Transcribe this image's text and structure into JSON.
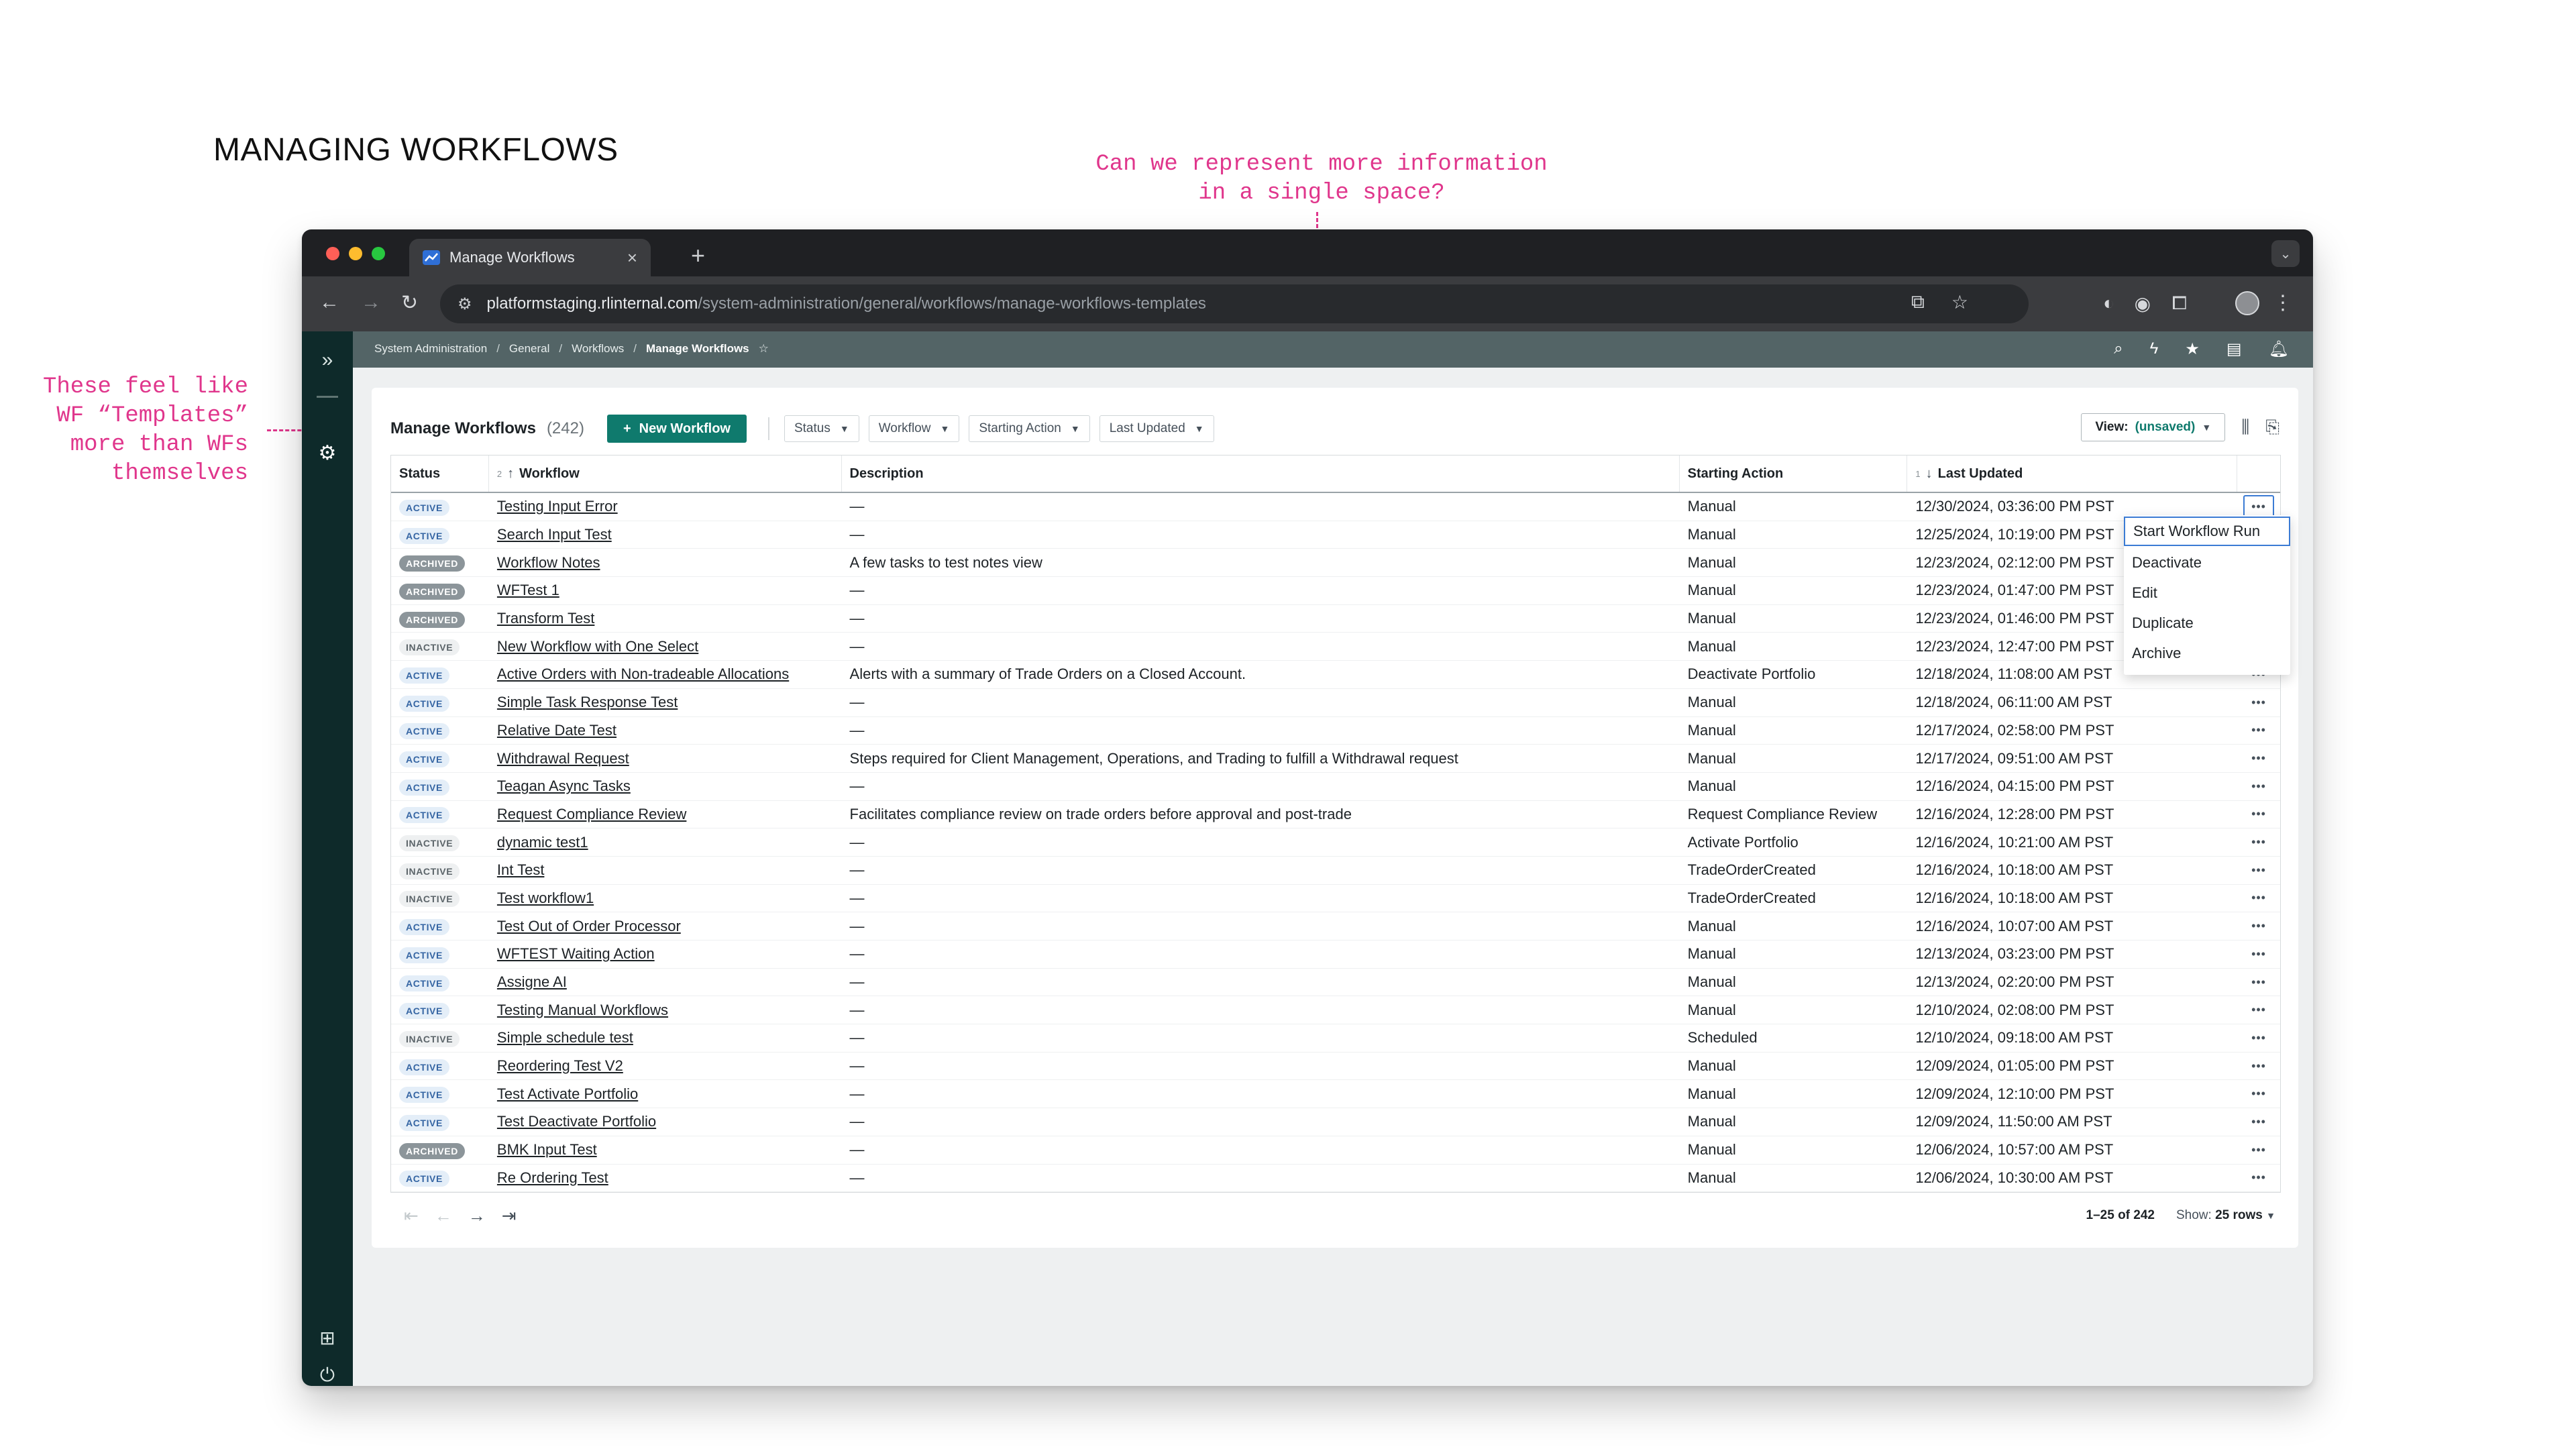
{
  "slide": {
    "title": "MANAGING WORKFLOWS",
    "annotation_top_line1": "Can we represent more information",
    "annotation_top_line2": "in a single space?",
    "annotation_left_line1": "These feel like",
    "annotation_left_line2": "WF “Templates”",
    "annotation_left_line3": "more than WFs",
    "annotation_left_line4": "themselves",
    "annotation_color": "#e0368c"
  },
  "browser": {
    "tab_title": "Manage Workflows",
    "url_host": "platformstaging.rlinternal.com",
    "url_path": "/system-administration/general/workflows/manage-workflows-templates"
  },
  "breadcrumb": [
    "System Administration",
    "General",
    "Workflows",
    "Manage Workflows"
  ],
  "toolbar": {
    "title": "Manage Workflows",
    "count": "(242)",
    "new_button": "New Workflow",
    "filters": [
      "Status",
      "Workflow",
      "Starting Action",
      "Last Updated"
    ],
    "view_label": "View:",
    "view_value": "(unsaved)"
  },
  "columns": {
    "status": "Status",
    "workflow": "Workflow",
    "workflow_sort_index": "2",
    "description": "Description",
    "starting_action": "Starting Action",
    "last_updated": "Last Updated",
    "last_updated_sort_index": "1"
  },
  "rows": [
    {
      "status": "ACTIVE",
      "workflow": "Testing Input Error",
      "description": "—",
      "action": "Manual",
      "updated": "12/30/2024, 03:36:00 PM PST"
    },
    {
      "status": "ACTIVE",
      "workflow": "Search Input Test",
      "description": "—",
      "action": "Manual",
      "updated": "12/25/2024, 10:19:00 PM PST"
    },
    {
      "status": "ARCHIVED",
      "workflow": "Workflow Notes",
      "description": "A few tasks to test notes view",
      "action": "Manual",
      "updated": "12/23/2024, 02:12:00 PM PST"
    },
    {
      "status": "ARCHIVED",
      "workflow": "WFTest 1",
      "description": "—",
      "action": "Manual",
      "updated": "12/23/2024, 01:47:00 PM PST"
    },
    {
      "status": "ARCHIVED",
      "workflow": "Transform Test",
      "description": "—",
      "action": "Manual",
      "updated": "12/23/2024, 01:46:00 PM PST"
    },
    {
      "status": "INACTIVE",
      "workflow": "New Workflow with One Select",
      "description": "—",
      "action": "Manual",
      "updated": "12/23/2024, 12:47:00 PM PST"
    },
    {
      "status": "ACTIVE",
      "workflow": "Active Orders with Non-tradeable Allocations",
      "description": "Alerts with a summary of Trade Orders on a Closed Account.",
      "action": "Deactivate Portfolio",
      "updated": "12/18/2024, 11:08:00 AM PST"
    },
    {
      "status": "ACTIVE",
      "workflow": "Simple Task Response Test",
      "description": "—",
      "action": "Manual",
      "updated": "12/18/2024, 06:11:00 AM PST"
    },
    {
      "status": "ACTIVE",
      "workflow": "Relative Date Test",
      "description": "—",
      "action": "Manual",
      "updated": "12/17/2024, 02:58:00 PM PST"
    },
    {
      "status": "ACTIVE",
      "workflow": "Withdrawal Request",
      "description": "Steps required for Client Management, Operations, and Trading to fulfill a Withdrawal request",
      "action": "Manual",
      "updated": "12/17/2024, 09:51:00 AM PST"
    },
    {
      "status": "ACTIVE",
      "workflow": "Teagan Async Tasks",
      "description": "—",
      "action": "Manual",
      "updated": "12/16/2024, 04:15:00 PM PST"
    },
    {
      "status": "ACTIVE",
      "workflow": "Request Compliance Review",
      "description": "Facilitates compliance review on trade orders before approval and post-trade",
      "action": "Request Compliance Review",
      "updated": "12/16/2024, 12:28:00 PM PST"
    },
    {
      "status": "INACTIVE",
      "workflow": "dynamic test1",
      "description": "—",
      "action": "Activate Portfolio",
      "updated": "12/16/2024, 10:21:00 AM PST"
    },
    {
      "status": "INACTIVE",
      "workflow": "Int Test",
      "description": "—",
      "action": "TradeOrderCreated",
      "updated": "12/16/2024, 10:18:00 AM PST"
    },
    {
      "status": "INACTIVE",
      "workflow": "Test workflow1",
      "description": "—",
      "action": "TradeOrderCreated",
      "updated": "12/16/2024, 10:18:00 AM PST"
    },
    {
      "status": "ACTIVE",
      "workflow": "Test Out of Order Processor",
      "description": "—",
      "action": "Manual",
      "updated": "12/16/2024, 10:07:00 AM PST"
    },
    {
      "status": "ACTIVE",
      "workflow": "WFTEST Waiting Action",
      "description": "—",
      "action": "Manual",
      "updated": "12/13/2024, 03:23:00 PM PST"
    },
    {
      "status": "ACTIVE",
      "workflow": "Assigne AI",
      "description": "—",
      "action": "Manual",
      "updated": "12/13/2024, 02:20:00 PM PST"
    },
    {
      "status": "ACTIVE",
      "workflow": "Testing Manual Workflows",
      "description": "—",
      "action": "Manual",
      "updated": "12/10/2024, 02:08:00 PM PST"
    },
    {
      "status": "INACTIVE",
      "workflow": "Simple schedule test",
      "description": "—",
      "action": "Scheduled",
      "updated": "12/10/2024, 09:18:00 AM PST"
    },
    {
      "status": "ACTIVE",
      "workflow": "Reordering Test V2",
      "description": "—",
      "action": "Manual",
      "updated": "12/09/2024, 01:05:00 PM PST"
    },
    {
      "status": "ACTIVE",
      "workflow": "Test Activate Portfolio",
      "description": "—",
      "action": "Manual",
      "updated": "12/09/2024, 12:10:00 PM PST"
    },
    {
      "status": "ACTIVE",
      "workflow": "Test Deactivate Portfolio",
      "description": "—",
      "action": "Manual",
      "updated": "12/09/2024, 11:50:00 AM PST"
    },
    {
      "status": "ARCHIVED",
      "workflow": "BMK Input Test",
      "description": "—",
      "action": "Manual",
      "updated": "12/06/2024, 10:57:00 AM PST"
    },
    {
      "status": "ACTIVE",
      "workflow": "Re Ordering Test",
      "description": "—",
      "action": "Manual",
      "updated": "12/06/2024, 10:30:00 AM PST"
    }
  ],
  "row_menu": [
    "Start Workflow Run",
    "Deactivate",
    "Edit",
    "Duplicate",
    "Archive"
  ],
  "pagination": {
    "range": "1–25 of 242",
    "show_label": "Show:",
    "show_value": "25 rows"
  }
}
